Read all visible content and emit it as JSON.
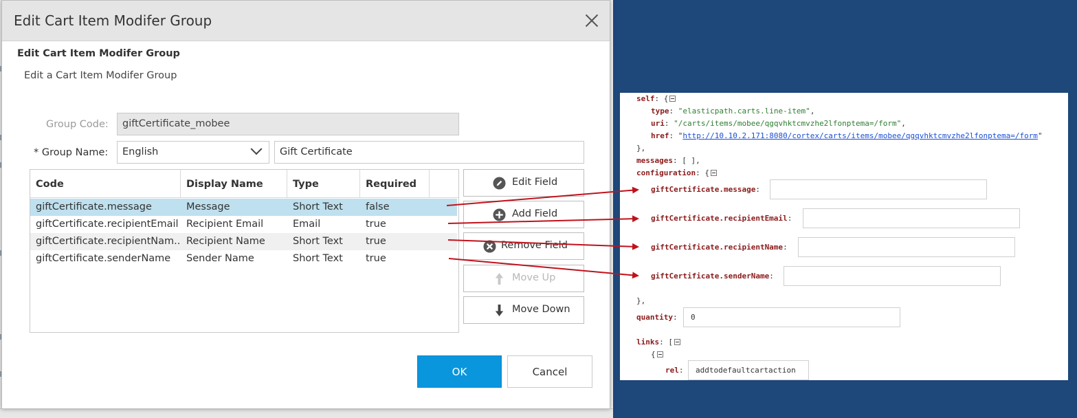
{
  "dialog": {
    "title": "Edit Cart Item Modifer Group",
    "heading": "Edit Cart Item Modifer Group",
    "subheading": "Edit a Cart Item Modifer Group"
  },
  "form": {
    "group_code_label": "Group Code:",
    "group_code_value": "giftCertificate_mobee",
    "group_name_label": "* Group Name:",
    "language": "English",
    "group_name_value": "Gift Certificate"
  },
  "table": {
    "columns": [
      "Code",
      "Display Name",
      "Type",
      "Required"
    ],
    "rows": [
      {
        "code": "giftCertificate.message",
        "display_name": "Message",
        "type": "Short Text",
        "required": "false"
      },
      {
        "code": "giftCertificate.recipientEmail",
        "display_name": "Recipient Email",
        "type": "Email",
        "required": "true"
      },
      {
        "code": "giftCertificate.recipientNam...",
        "display_name": "Recipient Name",
        "type": "Short Text",
        "required": "true"
      },
      {
        "code": "giftCertificate.senderName",
        "display_name": "Sender Name",
        "type": "Short Text",
        "required": "true"
      }
    ]
  },
  "actions": {
    "edit_field": "Edit Field",
    "add_field": "Add Field",
    "remove_field": "Remove Field",
    "move_up": "Move Up",
    "move_down": "Move Down"
  },
  "footer": {
    "ok": "OK",
    "cancel": "Cancel"
  },
  "panel": {
    "self_key": "self",
    "type_key": "type",
    "type_value": "\"elasticpath.carts.line-item\"",
    "uri_key": "uri",
    "uri_value": "\"/carts/items/mobee/qgqvhktcmvzhe2lfonptema=/form\"",
    "href_key": "href",
    "href_value": "http://10.10.2.171:8080/cortex/carts/items/mobee/qgqvhktcmvzhe2lfonptema=/form",
    "messages_key": "messages",
    "messages_value": "[ ],",
    "configuration_key": "configuration",
    "field_message": "giftCertificate.message",
    "field_recipientEmail": "giftCertificate.recipientEmail",
    "field_recipientName": "giftCertificate.recipientName",
    "field_senderName": "giftCertificate.senderName",
    "quantity_key": "quantity",
    "quantity_value": "0",
    "links_key": "links",
    "rel_key": "rel",
    "rel_value": "addtodefaultcartaction"
  },
  "colors": {
    "background": "#1e477a",
    "selected_row": "#bfe0ee",
    "ok_button": "#0a96dd",
    "arrow": "#c0121c",
    "json_key": "#8b1a1a",
    "json_string": "#2e7d32"
  }
}
